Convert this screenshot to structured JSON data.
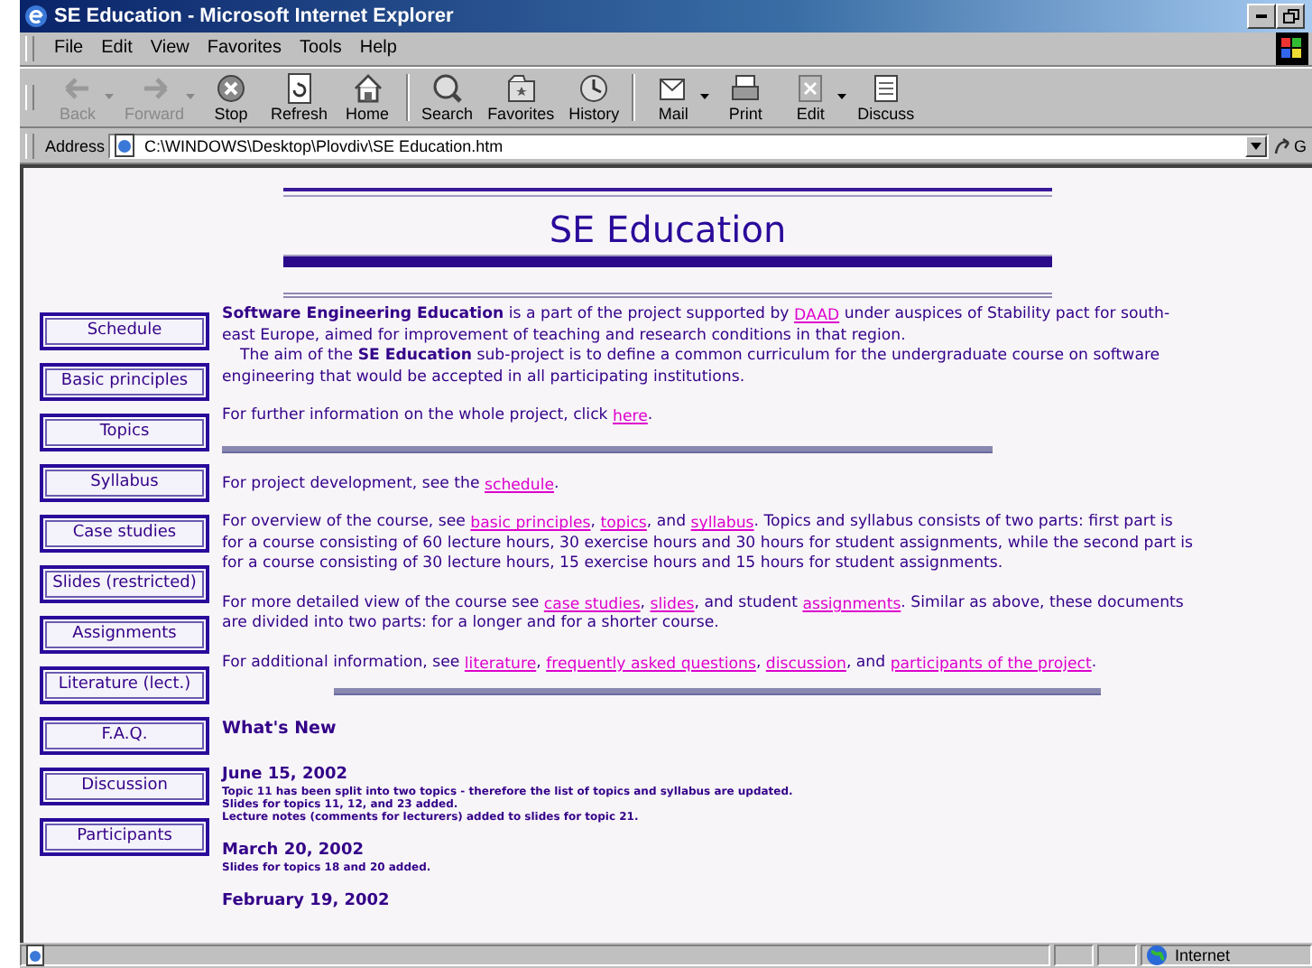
{
  "window": {
    "title": "SE Education - Microsoft Internet Explorer"
  },
  "menu": [
    {
      "label": "File"
    },
    {
      "label": "Edit"
    },
    {
      "label": "View"
    },
    {
      "label": "Favorites"
    },
    {
      "label": "Tools"
    },
    {
      "label": "Help"
    }
  ],
  "toolbar": [
    {
      "label": "Back",
      "kind": "back",
      "disabled": true,
      "dropdown": true
    },
    {
      "label": "Forward",
      "kind": "forward",
      "disabled": true,
      "dropdown": true
    },
    {
      "label": "Stop",
      "kind": "stop",
      "disabled": false,
      "dropdown": false
    },
    {
      "label": "Refresh",
      "kind": "refresh",
      "disabled": false,
      "dropdown": false
    },
    {
      "label": "Home",
      "kind": "home",
      "disabled": false,
      "dropdown": false
    },
    {
      "label": "Search",
      "kind": "search",
      "disabled": false,
      "dropdown": false
    },
    {
      "label": "Favorites",
      "kind": "favorites",
      "disabled": false,
      "dropdown": false
    },
    {
      "label": "History",
      "kind": "history",
      "disabled": false,
      "dropdown": false
    },
    {
      "label": "Mail",
      "kind": "mail",
      "disabled": false,
      "dropdown": true
    },
    {
      "label": "Print",
      "kind": "print",
      "disabled": false,
      "dropdown": false
    },
    {
      "label": "Edit",
      "kind": "edit",
      "disabled": false,
      "dropdown": true
    },
    {
      "label": "Discuss",
      "kind": "discuss",
      "disabled": false,
      "dropdown": false
    }
  ],
  "address": {
    "label": "Address",
    "value": "C:\\WINDOWS\\Desktop\\Plovdiv\\SE Education.htm",
    "go": "G"
  },
  "page": {
    "title": "SE Education",
    "nav": [
      "Schedule",
      "Basic principles",
      "Topics",
      "Syllabus",
      "Case studies",
      "Slides (restricted)",
      "Assignments",
      "Literature (lect.)",
      "F.A.Q.",
      "Discussion",
      "Participants"
    ],
    "content": [
      {
        "kind": "paragraph",
        "indent": false,
        "parts": [
          {
            "kind": "text",
            "text": "**Software Engineering Education** is a part of the project supported by "
          },
          {
            "kind": "link",
            "text": "DAAD"
          },
          {
            "kind": "text",
            "text": " under auspices of Stability pact for south-east Europe, aimed  for improvement of teaching and research conditions in that region."
          }
        ]
      },
      {
        "kind": "paragraph",
        "indent": true,
        "parts": [
          {
            "kind": "text",
            "text": "The aim of the **SE Education** sub-project is to define a common curriculum for the undergraduate course on software engineering that would be accepted in all participating institutions."
          }
        ]
      },
      {
        "kind": "paragraph",
        "indent": false,
        "parts": [
          {
            "kind": "text",
            "text": "For further information on the whole project, click "
          },
          {
            "kind": "link",
            "text": "here"
          },
          {
            "kind": "text",
            "text": "."
          }
        ]
      },
      {
        "kind": "rule",
        "indent": false
      },
      {
        "kind": "paragraph",
        "indent": false,
        "parts": [
          {
            "kind": "text",
            "text": "For project development, see the "
          },
          {
            "kind": "link",
            "text": "schedule"
          },
          {
            "kind": "text",
            "text": "."
          }
        ]
      },
      {
        "kind": "paragraph",
        "indent": false,
        "parts": [
          {
            "kind": "text",
            "text": "For overview of the course, see "
          },
          {
            "kind": "link",
            "text": "basic principles"
          },
          {
            "kind": "text",
            "text": ", "
          },
          {
            "kind": "link",
            "text": "topics"
          },
          {
            "kind": "text",
            "text": ", and "
          },
          {
            "kind": "link",
            "text": "syllabus"
          },
          {
            "kind": "text",
            "text": ". Topics and syllabus consists of two parts: first part is for a course consisting of 60 lecture hours, 30 exercise hours and 30 hours for student assignments, while the second part is for a course consisting of 30 lecture hours, 15 exercise hours and 15 hours for student assignments."
          }
        ]
      },
      {
        "kind": "paragraph",
        "indent": false,
        "parts": [
          {
            "kind": "text",
            "text": "For more detailed view of the course see "
          },
          {
            "kind": "link",
            "text": "case studies"
          },
          {
            "kind": "text",
            "text": ", "
          },
          {
            "kind": "link",
            "text": "slides"
          },
          {
            "kind": "text",
            "text": ", and student "
          },
          {
            "kind": "link",
            "text": "assignments"
          },
          {
            "kind": "text",
            "text": ". Similar as above, these documents are divided into two parts: for a longer and for a shorter course."
          }
        ]
      },
      {
        "kind": "paragraph",
        "indent": false,
        "parts": [
          {
            "kind": "text",
            "text": "For additional information, see "
          },
          {
            "kind": "link",
            "text": "literature"
          },
          {
            "kind": "text",
            "text": ", "
          },
          {
            "kind": "link",
            "text": "frequently asked questions"
          },
          {
            "kind": "text",
            "text": ", "
          },
          {
            "kind": "link",
            "text": "discussion"
          },
          {
            "kind": "text",
            "text": ", and "
          },
          {
            "kind": "link",
            "text": "participants of the project"
          },
          {
            "kind": "text",
            "text": "."
          }
        ]
      },
      {
        "kind": "rule",
        "indent": true
      }
    ],
    "whats_new": {
      "heading": "What's New",
      "entries": [
        {
          "date": "June 15, 2002",
          "lines": [
            "Topic 11 has been split into two topics - therefore the list of topics and syllabus are updated.",
            "Slides for topics 11, 12, and 23 added.",
            "Lecture notes (comments for lecturers) added to slides for topic 21."
          ]
        },
        {
          "date": "March 20, 2002",
          "lines": [
            "Slides for topics 18 and 20 added."
          ]
        },
        {
          "date": "February 19, 2002"
        }
      ]
    }
  },
  "status_bar": {
    "zone": "Internet"
  }
}
